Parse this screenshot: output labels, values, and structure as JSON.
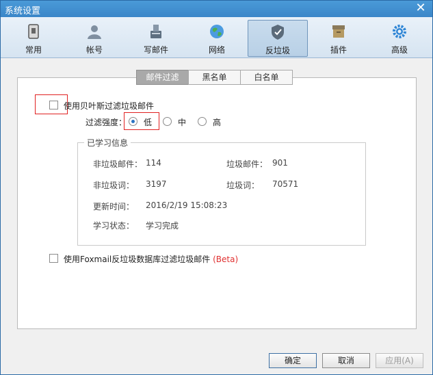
{
  "window": {
    "title": "系统设置"
  },
  "toolbar": {
    "items": [
      {
        "label": "常用",
        "icon": "phone-icon"
      },
      {
        "label": "帐号",
        "icon": "user-icon"
      },
      {
        "label": "写邮件",
        "icon": "compose-icon"
      },
      {
        "label": "网络",
        "icon": "globe-icon"
      },
      {
        "label": "反垃圾",
        "icon": "shield-icon"
      },
      {
        "label": "插件",
        "icon": "plugin-box-icon"
      },
      {
        "label": "高级",
        "icon": "gear-icon"
      }
    ],
    "active": "反垃圾"
  },
  "tabs": [
    {
      "label": "邮件过滤"
    },
    {
      "label": "黑名单"
    },
    {
      "label": "白名单"
    }
  ],
  "bayes": {
    "checkbox_label": "使用贝叶斯过滤垃圾邮件",
    "checked": false,
    "strength_label": "过滤强度：",
    "options": [
      {
        "label": "低",
        "checked": true
      },
      {
        "label": "中",
        "checked": false
      },
      {
        "label": "高",
        "checked": false
      }
    ]
  },
  "learned": {
    "title": "已学习信息",
    "non_spam_mail_label": "非垃圾邮件：",
    "non_spam_mail_value": "114",
    "spam_mail_label": "垃圾邮件：",
    "spam_mail_value": "901",
    "non_spam_words_label": "非垃圾词：",
    "non_spam_words_value": "3197",
    "spam_words_label": "垃圾词：",
    "spam_words_value": "70571",
    "update_time_label": "更新时间：",
    "update_time_value": "2016/2/19 15:08:23",
    "status_label": "学习状态：",
    "status_value": "学习完成"
  },
  "foxmail_db": {
    "checkbox_label": "使用Foxmail反垃圾数据库过滤垃圾邮件",
    "beta": "(Beta)",
    "checked": false
  },
  "buttons": {
    "ok": "确定",
    "cancel": "取消",
    "apply": "应用(A)"
  },
  "colors": {
    "accent": "#2a73c2",
    "highlight_red": "#e02020",
    "beta_red": "#e03030"
  }
}
